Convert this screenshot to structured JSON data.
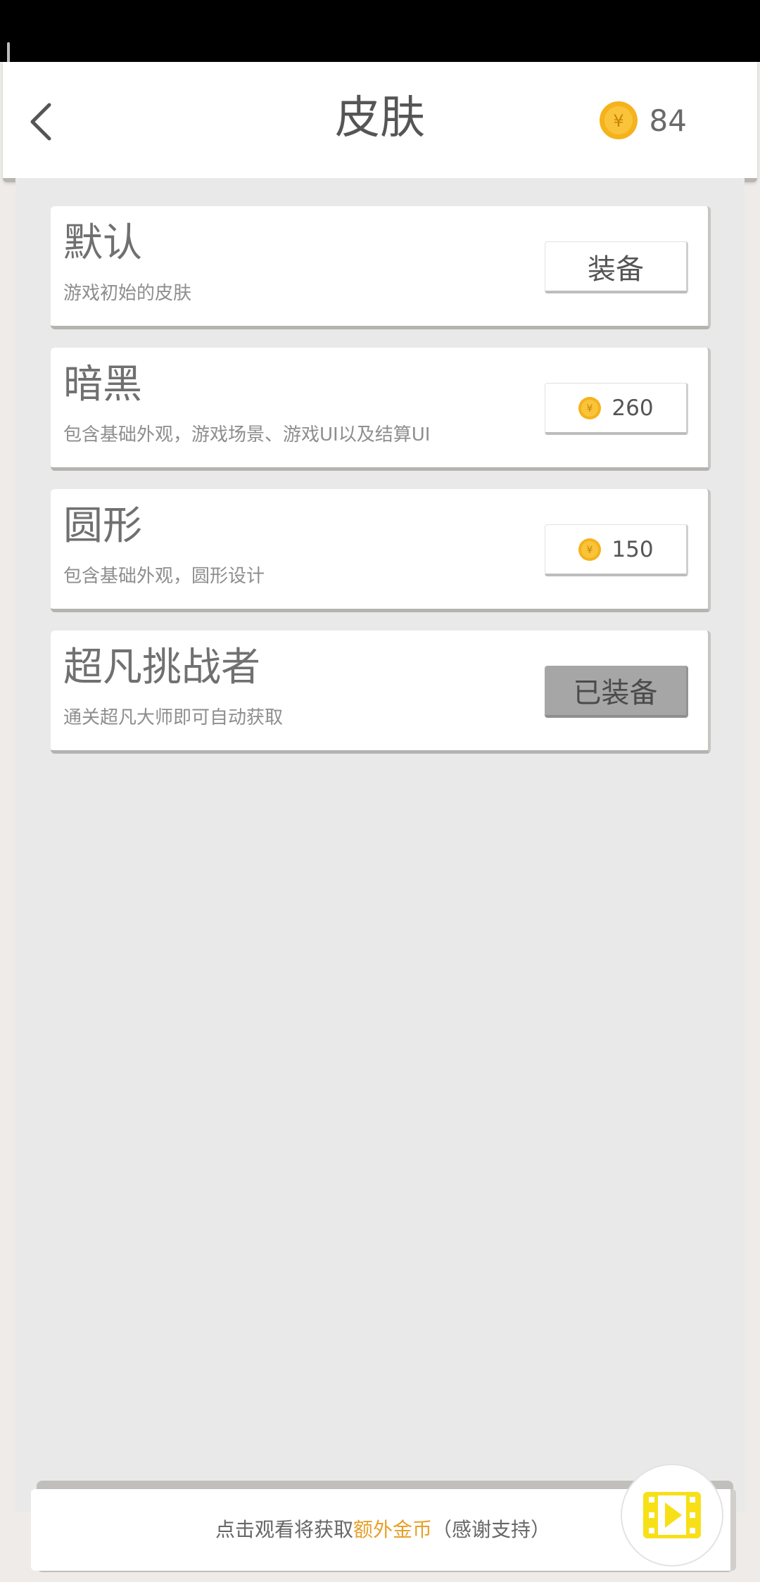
{
  "header": {
    "title": "皮肤",
    "back_icon": "chevron-left-icon",
    "coin_icon": "coin-icon",
    "coin_balance": "84"
  },
  "skins": [
    {
      "name": "默认",
      "description": "游戏初始的皮肤",
      "action": "装备"
    },
    {
      "name": "暗黑",
      "description": "包含基础外观，游戏场景、游戏UI以及结算UI",
      "price": "260"
    },
    {
      "name": "圆形",
      "description": "包含基础外观，圆形设计",
      "price": "150"
    },
    {
      "name": "超凡挑战者",
      "description": "通关超凡大师即可自动获取",
      "action": "已装备"
    }
  ],
  "ad_banner": {
    "text_prefix": "点击观看将获取",
    "text_highlight": "额外金币",
    "text_suffix": "（感谢支持）",
    "video_icon": "video-play-icon"
  },
  "colors": {
    "coin": "#f5b21c",
    "highlight": "#e6a12a",
    "video_icon": "#f7e017",
    "equipped_button": "#a6a6a6"
  }
}
